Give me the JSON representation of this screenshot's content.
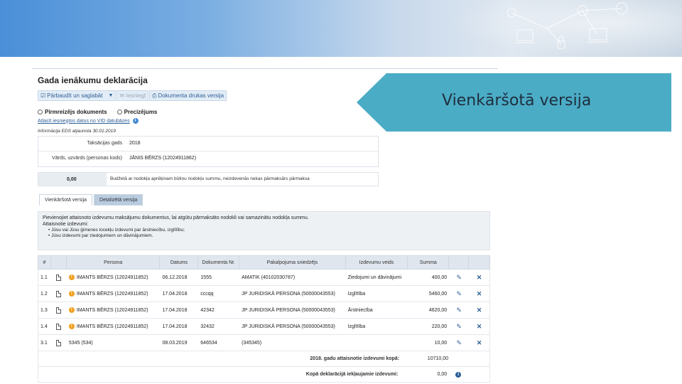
{
  "doc_title": "Gada ienākumu deklarācija",
  "toolbar": {
    "btn1": "Pārbaudīt un saglabāt",
    "btn2": "Iesniegt",
    "btn3": "Dokumenta drukas versija"
  },
  "radios": {
    "opt1": "Pirmreizējs dokuments",
    "opt2": "Precizējums"
  },
  "link_text": "Atlasīt iesniegtos datus no VID datubāzes",
  "eds_text": "Informācija EDS atjaunota 30.01.2019",
  "form": {
    "year_label": "Taksācijas gads",
    "year_value": "2018",
    "person_label": "Vārds, uzvārds (personas kods)",
    "person_value": "JĀNIS BĒRZS (12024911862)"
  },
  "summary": {
    "value": "0,00",
    "text": "Budžetā ar nodokļa aprēķinam būtiņu nodokļu summu, neizdevenās nekas pārmaksārs pārmaksa"
  },
  "tabs": {
    "tab1": "Vienkāršotā versija",
    "tab2": "Detalizētā versija"
  },
  "notice": {
    "line1": "Pievienojiet attaisnoto izdevumu maksājumu dokumentus, lai atgūtu pārmaksāto nodokli vai samazinātu nodokļa summu.",
    "line2": "Attaisnotie izdevumi:",
    "bullet1": "Jūsu vai Jūsu ģimenes locekļu izdevumi par ārstniecību, izglītību;",
    "bullet2": "Jūsu izdevumi par ziedojumiem un dāvinājumiem."
  },
  "table": {
    "headers": [
      "#",
      "",
      "Persona",
      "Datums",
      "Dokumenta Nr.",
      "Pakalpojuma sniedzējs",
      "Izdevumu veids",
      "Summa",
      "",
      ""
    ],
    "rows": [
      {
        "num": "1.1",
        "persona": "IMANTS BĒRZS (12024911852)",
        "datums": "06.12.2018",
        "doknr": "1555",
        "sniedzejs": "AMATIK (40102030787)",
        "veids": "Ziedojumi un dāvinājumi",
        "summa": "400,00"
      },
      {
        "num": "1.2",
        "persona": "IMANTS BĒRZS (12024911852)",
        "datums": "17.04.2018",
        "doknr": "cccqq",
        "sniedzejs": "JP JURIDISKĀ PERSONA (50000043553)",
        "veids": "Izglītība",
        "summa": "5460,00"
      },
      {
        "num": "1.3",
        "persona": "IMANTS BĒRZS (12024911852)",
        "datums": "17.04.2018",
        "doknr": "42342",
        "sniedzejs": "JP JURIDISKĀ PERSONA (50000043553)",
        "veids": "Ārstniecība",
        "summa": "4620,00"
      },
      {
        "num": "1.4",
        "persona": "IMANTS BĒRZS (12024911852)",
        "datums": "17.04.2018",
        "doknr": "32432",
        "sniedzejs": "JP JURIDISKĀ PERSONA (50000043553)",
        "veids": "Izglītība",
        "summa": "220,00"
      },
      {
        "num": "3.1",
        "persona": "5345 (534)",
        "datums": "08.03.2019",
        "doknr": "646534",
        "sniedzejs": "(345345)",
        "veids": "",
        "summa": "10,00"
      }
    ],
    "total1_label": "2018. gadu attaisnotie izdevumi kopā:",
    "total1_value": "10710,00",
    "total2_label": "Kopā deklarācijā iekļaujamie izdevumi:",
    "total2_value": "0,00"
  },
  "callout_text": "Vienkāršotā versija",
  "colors": {
    "callout": "#4bacc6",
    "link": "#2d5f96",
    "warning": "#f0a020"
  }
}
